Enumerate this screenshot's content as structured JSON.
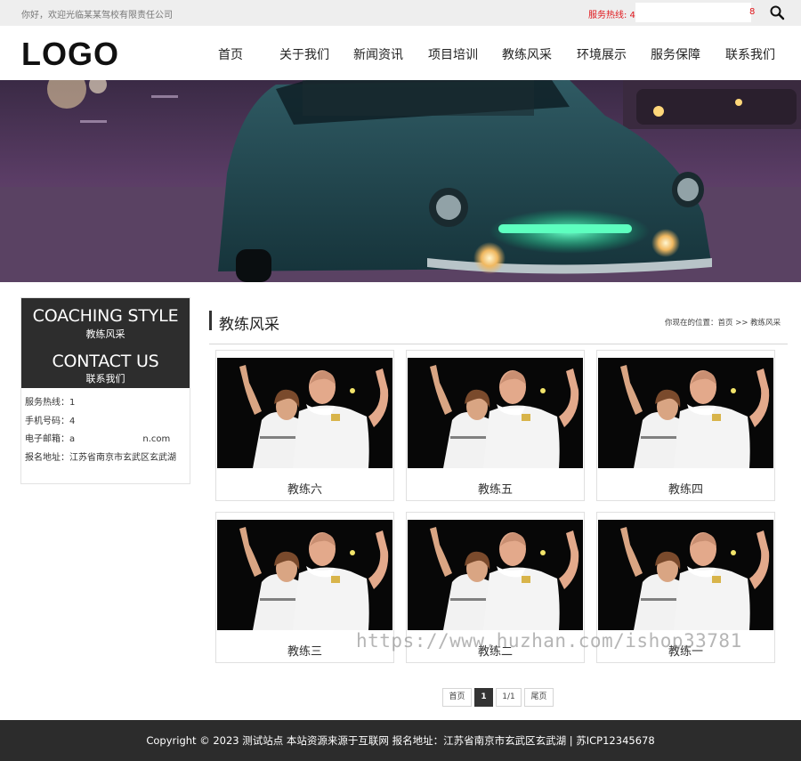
{
  "topbar": {
    "welcome": "你好，欢迎光临某某驾校有限责任公司",
    "hotline_prefix": "服务热线: 4(",
    "hotline_suffix": "8",
    "search_icon": "search-icon"
  },
  "header": {
    "logo": "LOGO",
    "nav": [
      "首页",
      "关于我们",
      "新闻资讯",
      "项目培训",
      "教练风采",
      "环境展示",
      "服务保障",
      "联系我们"
    ]
  },
  "sidebar": {
    "title_en": "COACHING STYLE",
    "title_cn": "教练风采",
    "contact_en": "CONTACT US",
    "contact_cn": "联系我们",
    "rows": [
      {
        "label": "服务热线：",
        "value": "1"
      },
      {
        "label": "手机号码：",
        "value": "4"
      },
      {
        "label": "电子邮箱：",
        "value": "a                        n.com"
      },
      {
        "label": "报名地址：",
        "value": "江苏省南京市玄武区玄武湖"
      }
    ]
  },
  "main": {
    "title": "教练风采",
    "breadcrumb": "你现在的位置：首页 >> 教练风采",
    "cards": [
      {
        "name": "教练六"
      },
      {
        "name": "教练五"
      },
      {
        "name": "教练四"
      },
      {
        "name": "教练三"
      },
      {
        "name": "教练二"
      },
      {
        "name": "教练一"
      }
    ]
  },
  "watermark": "https://www.huzhan.com/ishop33781",
  "pagination": {
    "first": "首页",
    "current": "1",
    "count": "1/1",
    "last": "尾页"
  },
  "footer": {
    "copyright": "Copyright © 2023 测试站点 本站资源来源于互联网  报名地址：江苏省南京市玄武区玄武湖 | 苏ICP12345678"
  },
  "colors": {
    "accent_red": "#e0161b",
    "dark": "#2d2d2d",
    "footer_bg": "#2c2c2c"
  }
}
